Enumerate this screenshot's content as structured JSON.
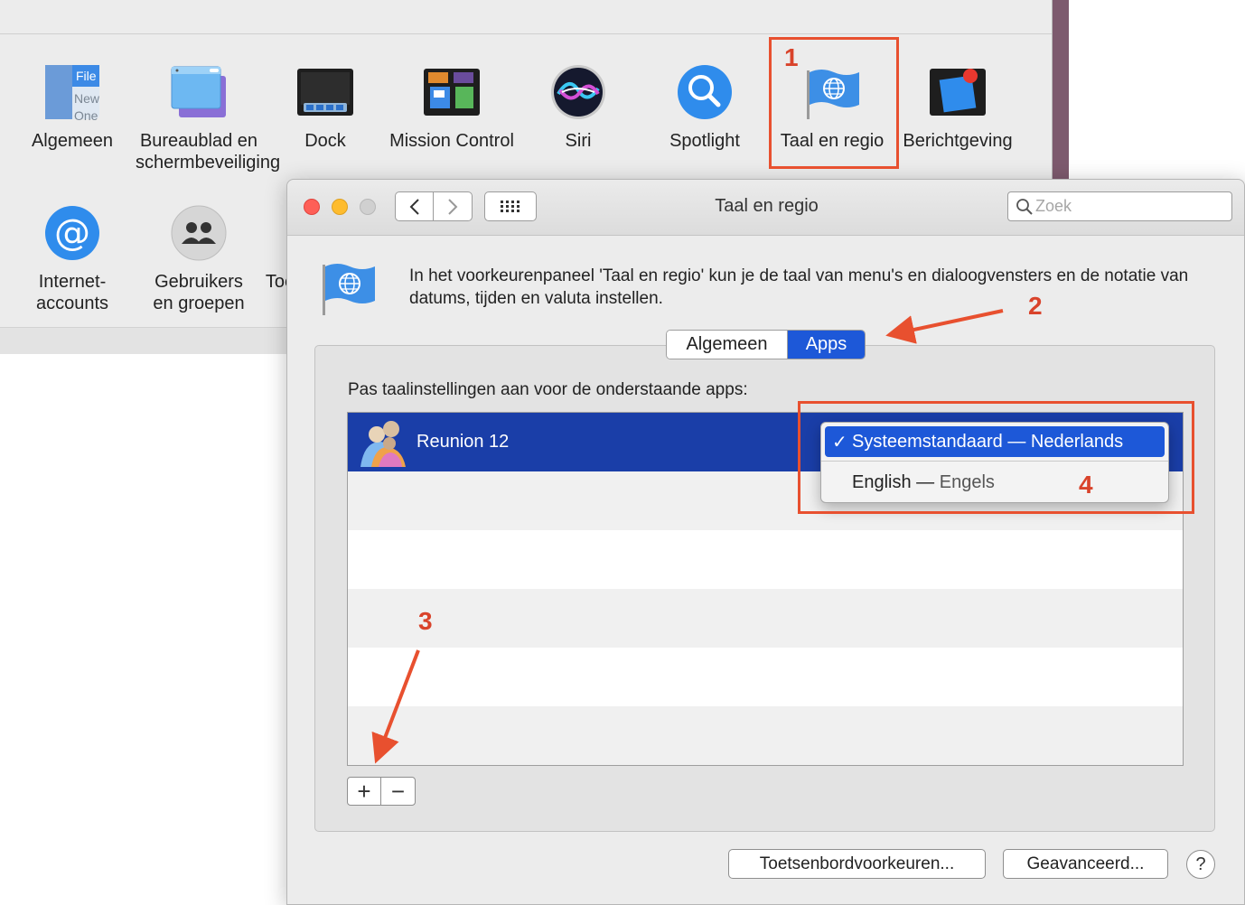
{
  "background_window": {
    "prefs": [
      {
        "label": "Algemeen",
        "icon": "general-icon"
      },
      {
        "label": "Bureaublad en schermbeveiliging",
        "icon": "desktop-icon"
      },
      {
        "label": "Dock",
        "icon": "dock-icon"
      },
      {
        "label": "Mission Control",
        "icon": "mission-control-icon"
      },
      {
        "label": "Siri",
        "icon": "siri-icon"
      },
      {
        "label": "Spotlight",
        "icon": "spotlight-icon"
      },
      {
        "label": "Taal en regio",
        "icon": "globe-flag-icon"
      },
      {
        "label": "Berichtgeving",
        "icon": "notifications-icon"
      },
      {
        "label": "Internet-accounts",
        "icon": "at-icon"
      },
      {
        "label": "Gebruikers en groepen",
        "icon": "users-icon"
      },
      {
        "label": "Toe",
        "icon": ""
      }
    ],
    "general_icon_text": [
      "File",
      "New",
      "One"
    ]
  },
  "window": {
    "title": "Taal en regio",
    "search_placeholder": "Zoek",
    "description": "In het voorkeurenpaneel 'Taal en regio' kun je de taal van menu's en dialoogvensters en de notatie van datums, tijden en valuta instellen.",
    "tabs": [
      {
        "label": "Algemeen",
        "selected": false
      },
      {
        "label": "Apps",
        "selected": true
      }
    ],
    "apps_label": "Pas taalinstellingen aan voor de onderstaande apps:",
    "apps": [
      {
        "name": "Reunion 12",
        "selected": true
      }
    ],
    "add_label": "+",
    "remove_label": "−",
    "buttons": {
      "keyboard": "Toetsenbordvoorkeuren...",
      "advanced": "Geavanceerd...",
      "help": "?"
    }
  },
  "language_menu": {
    "items": [
      {
        "check": "✓",
        "label": "Systeemstandaard",
        "dash": " — ",
        "sub": "Nederlands",
        "selected": true
      },
      {
        "check": "",
        "label": "English",
        "dash": " — ",
        "sub": "Engels",
        "selected": false
      }
    ]
  },
  "annotations": {
    "numbers": [
      "1",
      "2",
      "3",
      "4"
    ],
    "color": "#e8502f"
  },
  "colors": {
    "accent": "#1d58d8",
    "selected_row": "#1a3ea8",
    "close": "#fe5f57",
    "minimize": "#febc2e",
    "zoom": "#d0d0d0"
  }
}
